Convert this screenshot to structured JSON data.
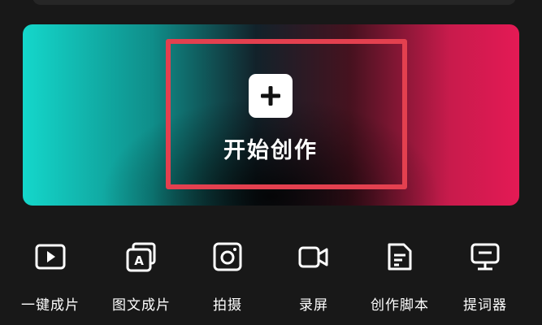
{
  "hero": {
    "start_label": "开始创作",
    "icon": "plus-icon"
  },
  "tools": [
    {
      "label": "一键成片",
      "icon": "play-video-icon"
    },
    {
      "label": "图文成片",
      "icon": "image-text-icon"
    },
    {
      "label": "拍摄",
      "icon": "camera-icon"
    },
    {
      "label": "录屏",
      "icon": "video-camera-icon"
    },
    {
      "label": "创作脚本",
      "icon": "script-document-icon"
    },
    {
      "label": "提词器",
      "icon": "teleprompter-icon"
    }
  ],
  "colors": {
    "background": "#181818",
    "highlight": "#e3404f",
    "gradient_left": "#14d7cb",
    "gradient_right": "#e41a55"
  }
}
